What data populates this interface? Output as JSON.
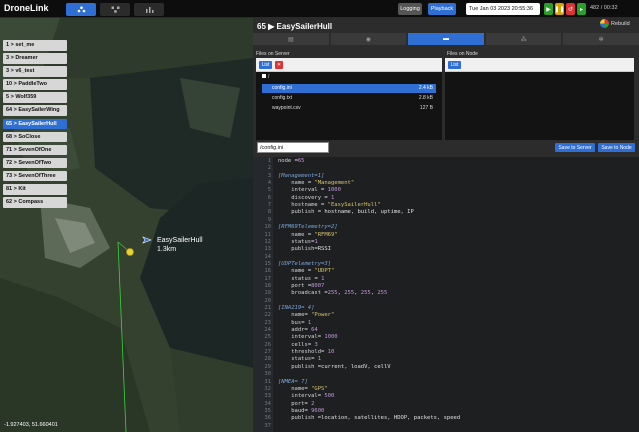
{
  "app": {
    "brand": "DroneLink"
  },
  "nav": {
    "tabs": [
      {
        "icon": "map-nodes-icon",
        "active": true
      },
      {
        "icon": "network-icon",
        "active": false
      },
      {
        "icon": "chart-icon",
        "active": false
      }
    ]
  },
  "toolbar": {
    "logging_label": "Logging",
    "playback_label": "Playback",
    "timestamp": "Tue Jan 03 2023 20:55:36",
    "readout": "482 / 00:32"
  },
  "nodes": [
    {
      "label": "1 > set_me",
      "active": false
    },
    {
      "label": "3 > Dreamer",
      "active": false
    },
    {
      "label": "3 > v6_test",
      "active": false
    },
    {
      "label": "10 > PaddleTwo",
      "active": false
    },
    {
      "label": "5 > Wolf359",
      "active": false
    },
    {
      "label": "64 > EasySailerWing",
      "active": false
    },
    {
      "label": "65 > EasySailerHull",
      "active": true
    },
    {
      "label": "68 > SoClose",
      "active": false
    },
    {
      "label": "71 > SevenOfOne",
      "active": false
    },
    {
      "label": "72 > SevenOfTwo",
      "active": false
    },
    {
      "label": "73 > SevenOfThree",
      "active": false
    },
    {
      "label": "81 > Kit",
      "active": false
    },
    {
      "label": "62 > Compass",
      "active": false
    }
  ],
  "map": {
    "boat_name": "EasySailerHull",
    "boat_distance": "1.3km",
    "coords": "-1.927403, 51.660401"
  },
  "panel": {
    "title": "65 ▶ EasySailerHull",
    "rebuild_label": "Rebuild",
    "subtabs": [
      {
        "icon": "table-icon",
        "active": false
      },
      {
        "icon": "eye-icon",
        "active": false
      },
      {
        "icon": "folder-icon",
        "active": true
      },
      {
        "icon": "network-icon",
        "active": false
      },
      {
        "icon": "gear-icon",
        "active": false
      }
    ]
  },
  "files_server": {
    "title": "Files on Server",
    "list_label": "List",
    "delete_label": "✕",
    "root": "/",
    "files": [
      {
        "name": "config.ini",
        "size": "2.4 kB",
        "active": true
      },
      {
        "name": "config.txt",
        "size": "2.8 kB",
        "active": false
      },
      {
        "name": "waypoint.csv",
        "size": "127 B",
        "active": false
      }
    ]
  },
  "files_node": {
    "title": "Files on Node",
    "list_label": "List"
  },
  "editor": {
    "path": "/config.ini",
    "save_server_label": "Save to Server",
    "save_node_label": "Save to Node",
    "lines": [
      {
        "n": "1",
        "parts": [
          [
            "key",
            "node "
          ],
          [
            "plain",
            "="
          ],
          [
            "num",
            "65"
          ]
        ]
      },
      {
        "n": "2",
        "parts": []
      },
      {
        "n": "3",
        "parts": [
          [
            "section",
            "[Management=1]"
          ]
        ]
      },
      {
        "n": "4",
        "parts": [
          [
            "key",
            "    name "
          ],
          [
            "plain",
            "= "
          ],
          [
            "str",
            "\"Management\""
          ]
        ]
      },
      {
        "n": "5",
        "parts": [
          [
            "key",
            "    interval "
          ],
          [
            "plain",
            "= "
          ],
          [
            "num",
            "1000"
          ]
        ]
      },
      {
        "n": "6",
        "parts": [
          [
            "key",
            "    discovery "
          ],
          [
            "plain",
            "= "
          ],
          [
            "num",
            "1"
          ]
        ]
      },
      {
        "n": "7",
        "parts": [
          [
            "key",
            "    hostname "
          ],
          [
            "plain",
            "= "
          ],
          [
            "str",
            "\"EasySailerHull\""
          ]
        ]
      },
      {
        "n": "8",
        "parts": [
          [
            "key",
            "    publish "
          ],
          [
            "plain",
            "= hostname, build, uptime, IP"
          ]
        ]
      },
      {
        "n": "9",
        "parts": []
      },
      {
        "n": "10",
        "parts": [
          [
            "section",
            "[RFM69Telemetry=2]"
          ]
        ]
      },
      {
        "n": "11",
        "parts": [
          [
            "key",
            "    name "
          ],
          [
            "plain",
            "= "
          ],
          [
            "str",
            "\"RFM69\""
          ]
        ]
      },
      {
        "n": "12",
        "parts": [
          [
            "key",
            "    status"
          ],
          [
            "plain",
            "="
          ],
          [
            "num",
            "1"
          ]
        ]
      },
      {
        "n": "13",
        "parts": [
          [
            "key",
            "    publish"
          ],
          [
            "plain",
            "=RSSI"
          ]
        ]
      },
      {
        "n": "14",
        "parts": []
      },
      {
        "n": "15",
        "parts": [
          [
            "section",
            "[UDPTelemetry=3]"
          ]
        ]
      },
      {
        "n": "16",
        "parts": [
          [
            "key",
            "    name "
          ],
          [
            "plain",
            "= "
          ],
          [
            "str",
            "\"UDPT\""
          ]
        ]
      },
      {
        "n": "17",
        "parts": [
          [
            "key",
            "    status "
          ],
          [
            "plain",
            "= "
          ],
          [
            "num",
            "1"
          ]
        ]
      },
      {
        "n": "18",
        "parts": [
          [
            "key",
            "    port "
          ],
          [
            "plain",
            "="
          ],
          [
            "num",
            "8007"
          ]
        ]
      },
      {
        "n": "19",
        "parts": [
          [
            "key",
            "    broadcast "
          ],
          [
            "plain",
            "="
          ],
          [
            "num",
            "255"
          ],
          [
            "plain",
            ", "
          ],
          [
            "num",
            "255"
          ],
          [
            "plain",
            ", "
          ],
          [
            "num",
            "255"
          ],
          [
            "plain",
            ", "
          ],
          [
            "num",
            "255"
          ]
        ]
      },
      {
        "n": "20",
        "parts": []
      },
      {
        "n": "21",
        "parts": [
          [
            "section",
            "[INA219= 4]"
          ]
        ]
      },
      {
        "n": "22",
        "parts": [
          [
            "key",
            "    name"
          ],
          [
            "plain",
            "= "
          ],
          [
            "str",
            "\"Power\""
          ]
        ]
      },
      {
        "n": "23",
        "parts": [
          [
            "key",
            "    bus"
          ],
          [
            "plain",
            "= "
          ],
          [
            "num",
            "1"
          ]
        ]
      },
      {
        "n": "24",
        "parts": [
          [
            "key",
            "    addr"
          ],
          [
            "plain",
            "= "
          ],
          [
            "num",
            "64"
          ]
        ]
      },
      {
        "n": "25",
        "parts": [
          [
            "key",
            "    interval"
          ],
          [
            "plain",
            "= "
          ],
          [
            "num",
            "1000"
          ]
        ]
      },
      {
        "n": "26",
        "parts": [
          [
            "key",
            "    cells"
          ],
          [
            "plain",
            "= "
          ],
          [
            "num",
            "3"
          ]
        ]
      },
      {
        "n": "27",
        "parts": [
          [
            "key",
            "    threshold"
          ],
          [
            "plain",
            "= "
          ],
          [
            "num",
            "10"
          ]
        ]
      },
      {
        "n": "28",
        "parts": [
          [
            "key",
            "    status"
          ],
          [
            "plain",
            "= "
          ],
          [
            "num",
            "1"
          ]
        ]
      },
      {
        "n": "29",
        "parts": [
          [
            "key",
            "    publish "
          ],
          [
            "plain",
            "=current, loadV, cellV"
          ]
        ]
      },
      {
        "n": "30",
        "parts": []
      },
      {
        "n": "31",
        "parts": [
          [
            "section",
            "[NMEA= 7]"
          ]
        ]
      },
      {
        "n": "32",
        "parts": [
          [
            "key",
            "    name"
          ],
          [
            "plain",
            "= "
          ],
          [
            "str",
            "\"GPS\""
          ]
        ]
      },
      {
        "n": "33",
        "parts": [
          [
            "key",
            "    interval"
          ],
          [
            "plain",
            "= "
          ],
          [
            "num",
            "500"
          ]
        ]
      },
      {
        "n": "34",
        "parts": [
          [
            "key",
            "    port"
          ],
          [
            "plain",
            "= "
          ],
          [
            "num",
            "2"
          ]
        ]
      },
      {
        "n": "35",
        "parts": [
          [
            "key",
            "    baud"
          ],
          [
            "plain",
            "= "
          ],
          [
            "num",
            "9600"
          ]
        ]
      },
      {
        "n": "36",
        "parts": [
          [
            "key",
            "    publish "
          ],
          [
            "plain",
            "=location, satellites, HDOP, packets, speed"
          ]
        ]
      },
      {
        "n": "37",
        "parts": []
      }
    ]
  }
}
